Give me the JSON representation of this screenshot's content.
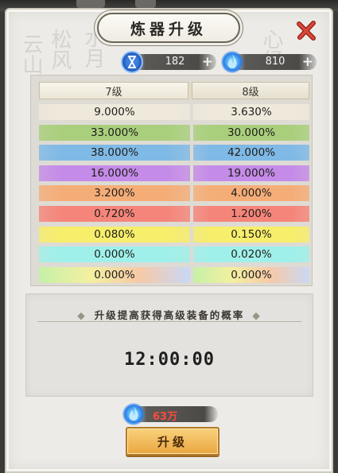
{
  "title": "炼器升级",
  "resources": [
    {
      "icon": "hourglass-icon",
      "value": "182",
      "plus": "+"
    },
    {
      "icon": "blue-flame-icon",
      "value": "810",
      "plus": "+"
    }
  ],
  "table": {
    "headers": [
      "7级",
      "8级"
    ],
    "rows": [
      {
        "left": "9.000%",
        "right": "3.630%",
        "color": "#efe9dc"
      },
      {
        "left": "33.000%",
        "right": "30.000%",
        "color": "#a9cf7c"
      },
      {
        "left": "38.000%",
        "right": "42.000%",
        "color": "#7fb9e6"
      },
      {
        "left": "16.000%",
        "right": "19.000%",
        "color": "#c48be8"
      },
      {
        "left": "3.200%",
        "right": "4.000%",
        "color": "#f5ad78"
      },
      {
        "left": "0.720%",
        "right": "1.200%",
        "color": "#f5857a"
      },
      {
        "left": "0.080%",
        "right": "0.150%",
        "color": "#f7ee6b"
      },
      {
        "left": "0.000%",
        "right": "0.020%",
        "color": "#9ff0ea"
      },
      {
        "left": "0.000%",
        "right": "0.000%",
        "color": "rainbow"
      }
    ]
  },
  "info": {
    "caption": "升级提高获得高级装备的概率",
    "timer": "12:00:00"
  },
  "cost": {
    "icon": "blue-flame-icon",
    "value": "63万"
  },
  "upgrade_button": "升级",
  "colors": {
    "accent": "#eaa63f",
    "cost_text": "#ff4a3d",
    "close_x": "#c0392b"
  }
}
